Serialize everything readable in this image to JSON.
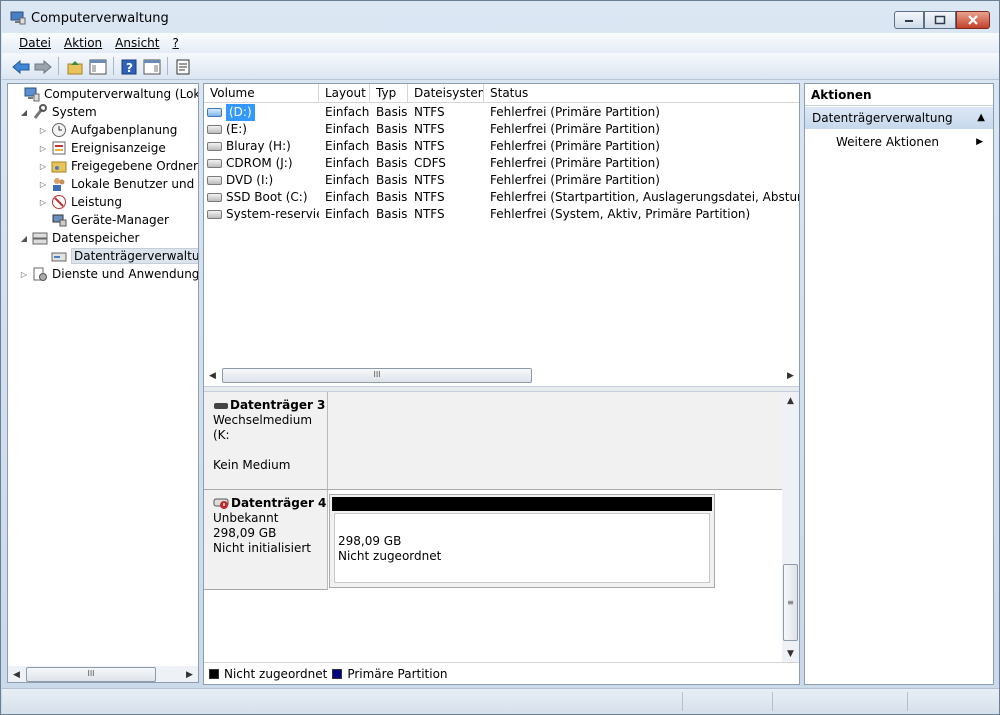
{
  "window": {
    "title": "Computerverwaltung"
  },
  "menu": [
    "Datei",
    "Aktion",
    "Ansicht",
    "?"
  ],
  "tree": {
    "items": [
      {
        "label": "Computerverwaltung (Lokal)",
        "level": 0,
        "expander": "",
        "icon": "computer-icon"
      },
      {
        "label": "System",
        "level": 1,
        "expander": "◢",
        "icon": "tools-icon"
      },
      {
        "label": "Aufgabenplanung",
        "level": 2,
        "expander": "▷",
        "icon": "clock-icon"
      },
      {
        "label": "Ereignisanzeige",
        "level": 2,
        "expander": "▷",
        "icon": "event-viewer-icon"
      },
      {
        "label": "Freigegebene Ordner",
        "level": 2,
        "expander": "▷",
        "icon": "shared-folder-icon"
      },
      {
        "label": "Lokale Benutzer und Gruppen",
        "level": 2,
        "expander": "▷",
        "icon": "users-icon"
      },
      {
        "label": "Leistung",
        "level": 2,
        "expander": "▷",
        "icon": "performance-icon"
      },
      {
        "label": "Geräte-Manager",
        "level": 2,
        "expander": "",
        "icon": "device-manager-icon"
      },
      {
        "label": "Datenspeicher",
        "level": 1,
        "expander": "◢",
        "icon": "storage-icon"
      },
      {
        "label": "Datenträgerverwaltung",
        "level": 2,
        "expander": "",
        "icon": "disk-management-icon",
        "selected": true
      },
      {
        "label": "Dienste und Anwendungen",
        "level": 1,
        "expander": "▷",
        "icon": "services-icon"
      }
    ]
  },
  "volumes": {
    "columns": [
      "Volume",
      "Layout",
      "Typ",
      "Dateisystem",
      "Status"
    ],
    "rows": [
      {
        "volume": "(D:)",
        "layout": "Einfach",
        "typ": "Basis",
        "fs": "NTFS",
        "status": "Fehlerfrei (Primäre Partition)",
        "selected": true
      },
      {
        "volume": "(E:)",
        "layout": "Einfach",
        "typ": "Basis",
        "fs": "NTFS",
        "status": "Fehlerfrei (Primäre Partition)"
      },
      {
        "volume": "Bluray (H:)",
        "layout": "Einfach",
        "typ": "Basis",
        "fs": "NTFS",
        "status": "Fehlerfrei (Primäre Partition)"
      },
      {
        "volume": "CDROM (J:)",
        "layout": "Einfach",
        "typ": "Basis",
        "fs": "CDFS",
        "status": "Fehlerfrei (Primäre Partition)"
      },
      {
        "volume": "DVD (I:)",
        "layout": "Einfach",
        "typ": "Basis",
        "fs": "NTFS",
        "status": "Fehlerfrei (Primäre Partition)"
      },
      {
        "volume": "SSD Boot (C:)",
        "layout": "Einfach",
        "typ": "Basis",
        "fs": "NTFS",
        "status": "Fehlerfrei (Startpartition, Auslagerungsdatei, Absturzabbild"
      },
      {
        "volume": "System-reserviert",
        "layout": "Einfach",
        "typ": "Basis",
        "fs": "NTFS",
        "status": "Fehlerfrei (System, Aktiv, Primäre Partition)"
      }
    ]
  },
  "disks": [
    {
      "name": "Datenträger 3",
      "line1": "Wechselmedium (K:",
      "line2": "",
      "line3": "Kein Medium"
    },
    {
      "name": "Datenträger 4",
      "line1": "Unbekannt",
      "line2": "298,09 GB",
      "line3": "Nicht initialisiert",
      "partition": {
        "size": "298,09 GB",
        "state": "Nicht zugeordnet"
      }
    }
  ],
  "legend": [
    {
      "label": "Nicht zugeordnet",
      "color": "#000000"
    },
    {
      "label": "Primäre Partition",
      "color": "#000080"
    }
  ],
  "actions": {
    "header": "Aktionen",
    "section": "Datenträgerverwaltung",
    "item": "Weitere Aktionen"
  },
  "scroll_glyph": "III",
  "colors": {
    "selection": "#3399ff",
    "unallocated": "#000000",
    "primary": "#000080"
  }
}
